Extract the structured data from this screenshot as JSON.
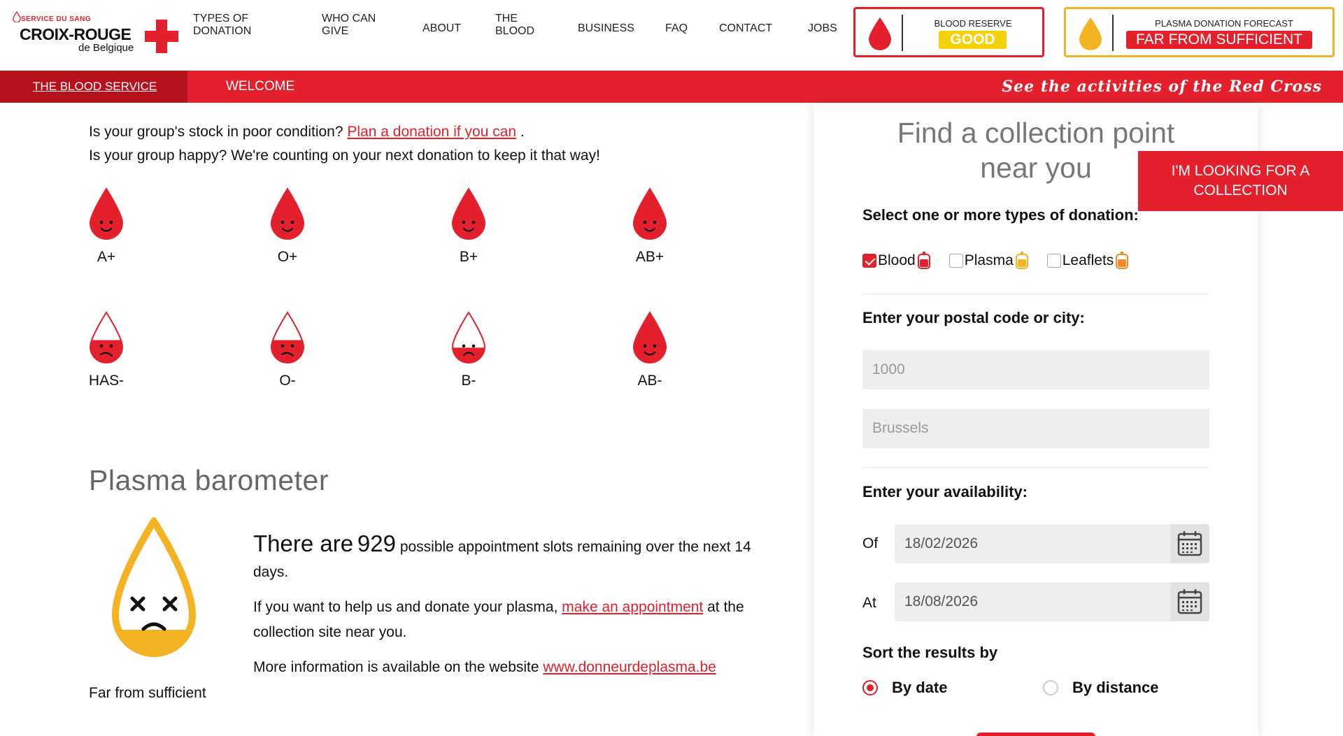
{
  "logo": {
    "service": "SERVICE DU SANG",
    "name": "CROIX-ROUGE",
    "sub": "de Belgique"
  },
  "nav": {
    "items": [
      {
        "label": "TYPES OF DONATION",
        "line1": "TYPES OF",
        "line2": "DONATION"
      },
      {
        "label": "WHO CAN GIVE",
        "line1": "WHO CAN",
        "line2": "GIVE"
      },
      {
        "label": "ABOUT",
        "line1": "ABOUT",
        "line2": ""
      },
      {
        "label": "THE BLOOD",
        "line1": "THE",
        "line2": "BLOOD"
      },
      {
        "label": "BUSINESS",
        "line1": "BUSINESS",
        "line2": ""
      },
      {
        "label": "FAQ",
        "line1": "FAQ",
        "line2": ""
      },
      {
        "label": "CONTACT",
        "line1": "CONTACT",
        "line2": ""
      },
      {
        "label": "JOBS",
        "line1": "JOBS",
        "line2": ""
      }
    ]
  },
  "badges": {
    "blood": {
      "title": "BLOOD RESERVE",
      "value": "GOOD",
      "color": "#e3202c",
      "value_bg": "#f4d20a"
    },
    "plasma": {
      "title": "PLASMA DONATION FORECAST",
      "value": "FAR FROM SUFFICIENT",
      "color": "#f3b323",
      "value_bg": "#e3202c"
    }
  },
  "subnav": {
    "active": "THE BLOOD SERVICE",
    "tab": "WELCOME",
    "activities": "See the activities of the Red Cross"
  },
  "intro": {
    "line1_prefix": "Is your group's stock in poor condition?",
    "line1_link": "Plan a donation if you can",
    "line1_suffix": ".",
    "line2": "Is your group happy? We're counting on your next donation to keep it that way!"
  },
  "blood_groups": [
    {
      "label": "A+",
      "level": 1.0,
      "mood": "happy"
    },
    {
      "label": "O+",
      "level": 1.0,
      "mood": "happy"
    },
    {
      "label": "B+",
      "level": 1.0,
      "mood": "happy"
    },
    {
      "label": "AB+",
      "level": 1.0,
      "mood": "happy"
    },
    {
      "label": "HAS-",
      "level": 0.45,
      "mood": "worried"
    },
    {
      "label": "O-",
      "level": 0.45,
      "mood": "worried"
    },
    {
      "label": "B-",
      "level": 0.3,
      "mood": "sad"
    },
    {
      "label": "AB-",
      "level": 1.0,
      "mood": "happy"
    }
  ],
  "plasma": {
    "title": "Plasma barometer",
    "caption": "Far from sufficient",
    "slots_prefix": "There are",
    "slots_count": "929",
    "slots_suffix": "possible appointment slots remaining over the next 14 days.",
    "help_prefix": "If you want to help us and donate your plasma,",
    "help_link": "make an appointment",
    "help_suffix": "at the collection site near you.",
    "more_prefix": "More information is available on the website",
    "more_link": "www.donneurdeplasma.be",
    "level": 0.18
  },
  "finder": {
    "title": "Find a collection point near you",
    "looking_button": "I'M LOOKING FOR A COLLECTION",
    "types_label": "Select one or more types of donation:",
    "types": [
      {
        "label": "Blood",
        "checked": true,
        "bag_color": "#e3202c"
      },
      {
        "label": "Plasma",
        "checked": false,
        "bag_color": "#f3b323"
      },
      {
        "label": "Leaflets",
        "checked": false,
        "bag_color": "#f08a24"
      }
    ],
    "location_label": "Enter your postal code or city:",
    "postal_placeholder": "1000",
    "city_placeholder": "Brussels",
    "availability_label": "Enter your availability:",
    "from_label": "Of",
    "from_value": "18/02/2026",
    "to_label": "At",
    "to_value": "18/08/2026",
    "sort_label": "Sort the results by",
    "sort_options": [
      {
        "label": "By date",
        "selected": true
      },
      {
        "label": "By distance",
        "selected": false
      }
    ]
  }
}
